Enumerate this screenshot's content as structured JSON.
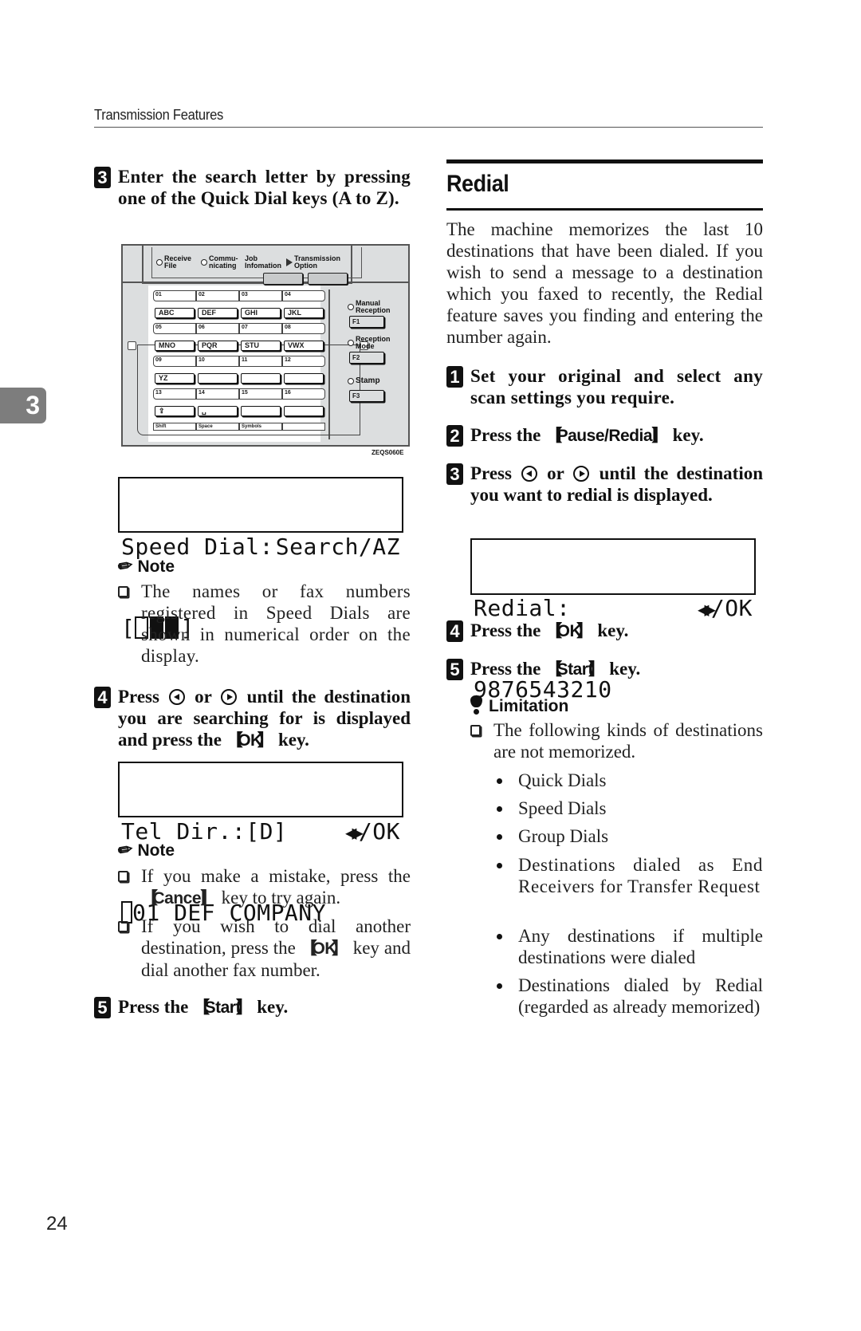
{
  "header": {
    "running_head": "Transmission Features",
    "chapter_tab": "3",
    "page_number": "24"
  },
  "left_column": {
    "step3": {
      "number": "3",
      "text": "Enter the search letter by pressing one of the Quick Dial keys (A to Z)."
    },
    "panel_figure": {
      "indicators": [
        {
          "icon": "led-icon",
          "line1": "Receive",
          "line2": "File"
        },
        {
          "icon": "led-icon",
          "line1": "Commu-",
          "line2": "nicating"
        },
        {
          "icon": "",
          "line1": "Job",
          "line2": "Infomation"
        },
        {
          "icon": "triangle-icon",
          "line1": "Transmission",
          "line2": "Option"
        }
      ],
      "number_rows": [
        [
          "01",
          "02",
          "03",
          "04"
        ],
        [
          "05",
          "06",
          "07",
          "08"
        ],
        [
          "09",
          "10",
          "11",
          "12"
        ],
        [
          "13",
          "14",
          "15",
          "16"
        ]
      ],
      "letter_rows": [
        [
          "ABC",
          "DEF",
          "GHI",
          "JKL"
        ],
        [
          "MNO",
          "PQR",
          "STU",
          "VWX"
        ],
        [
          "YZ",
          "",
          "",
          ""
        ],
        [
          "⇪",
          "␣",
          "",
          ""
        ]
      ],
      "bottom_labels": [
        "Shift",
        "Space",
        "Symbols",
        ""
      ],
      "function_keys": [
        {
          "indicator_line1": "Manual",
          "indicator_line2": "Reception",
          "key": "F1"
        },
        {
          "indicator_line1": "Reception",
          "indicator_line2": "Mode",
          "key": "F2"
        },
        {
          "indicator_line1": "Stamp",
          "indicator_line2": "",
          "key": "F3"
        }
      ],
      "caption": "ZEQS060E"
    },
    "lcd1": {
      "line1_left": "Speed Dial:",
      "line1_right": "Search/AZ",
      "line2_open": "[",
      "line2_close": "]"
    },
    "note1": {
      "heading": "Note",
      "items": [
        "The names or fax numbers registered in Speed Dials are shown in numerical order on the display."
      ]
    },
    "step4": {
      "number": "4",
      "text_before": "Press",
      "text_or": "or",
      "text_after": "until the destination you are searching for is displayed and press the",
      "key": "OK",
      "text_end": "key."
    },
    "lcd2": {
      "line1_left": "Tel Dir.:[D]",
      "line1_right": "/OK",
      "arrows": "◀▶",
      "line2": "01 DEF COMPANY"
    },
    "note2": {
      "heading": "Note",
      "item1_before": "If you make a mistake, press the",
      "item1_key": "Cancel",
      "item1_after": "key to try again.",
      "item2_before": "If you wish to dial another destination, press the",
      "item2_key": "OK",
      "item2_after": "key and dial another fax number."
    },
    "step5": {
      "number": "5",
      "text_before": "Press the",
      "key": "Start",
      "text_after": "key."
    }
  },
  "right_column": {
    "section_title": "Redial",
    "intro": "The machine memorizes the last 10 destinations that have been dialed. If you wish to send a message to a destination which you faxed to recently, the Redial feature saves you finding and entering the number again.",
    "step1": {
      "number": "1",
      "text": "Set your original and select any scan settings you require."
    },
    "step2": {
      "number": "2",
      "text_before": "Press the",
      "key": "Pause/Redial",
      "text_after": "key."
    },
    "step3": {
      "number": "3",
      "text_before": "Press",
      "text_or": "or",
      "text_after": "until the destination you want to redial is displayed."
    },
    "lcd3": {
      "line1_left": "Redial:",
      "arrows": "◀▶",
      "line1_right": "/OK",
      "line2": "9876543210"
    },
    "step4": {
      "number": "4",
      "text_before": "Press the",
      "key": "OK",
      "text_after": "key."
    },
    "step5": {
      "number": "5",
      "text_before": "Press the",
      "key": "Start",
      "text_after": "key."
    },
    "limitation": {
      "heading": "Limitation",
      "item": "The following kinds of destinations are not memorized.",
      "bullets": [
        "Quick Dials",
        "Speed Dials",
        "Group Dials",
        "Destinations dialed as End Receivers for Transfer Request",
        "Any destinations if multiple destinations were dialed",
        "Destinations dialed by Redial (regarded as already memorized)"
      ]
    }
  }
}
